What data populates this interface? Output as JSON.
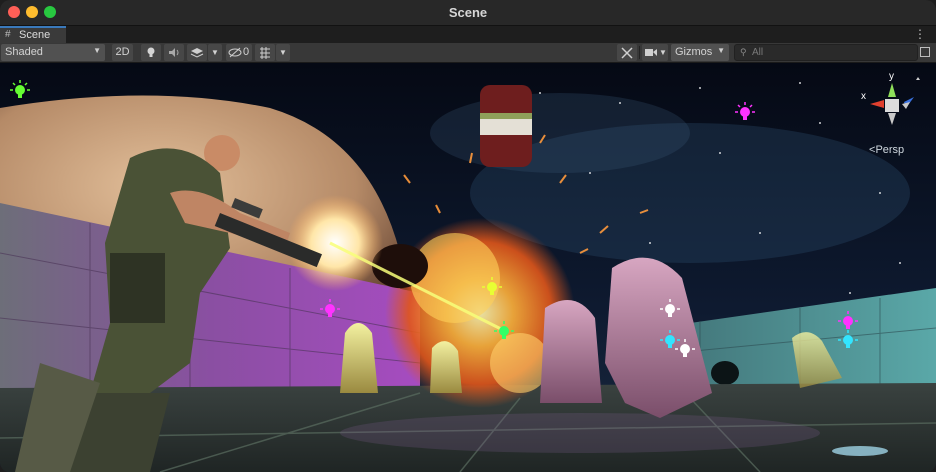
{
  "window": {
    "title": "Scene"
  },
  "tab": {
    "label": "Scene",
    "icon": "grid-icon"
  },
  "toolbar": {
    "draw_mode": "Shaded",
    "mode_2d": "2D",
    "hidden_count": "0",
    "gizmos": "Gizmos",
    "search_placeholder": "All"
  },
  "orientation_gizmo": {
    "label": "Persp",
    "x_label": "x",
    "y_label": "y"
  },
  "colors": {
    "accent": "#3a79bb",
    "light_green": "#66ff33",
    "light_magenta": "#ff33ff",
    "light_yellow": "#e8ff33",
    "light_white": "#ffffff",
    "light_cyan": "#33e5ff"
  }
}
